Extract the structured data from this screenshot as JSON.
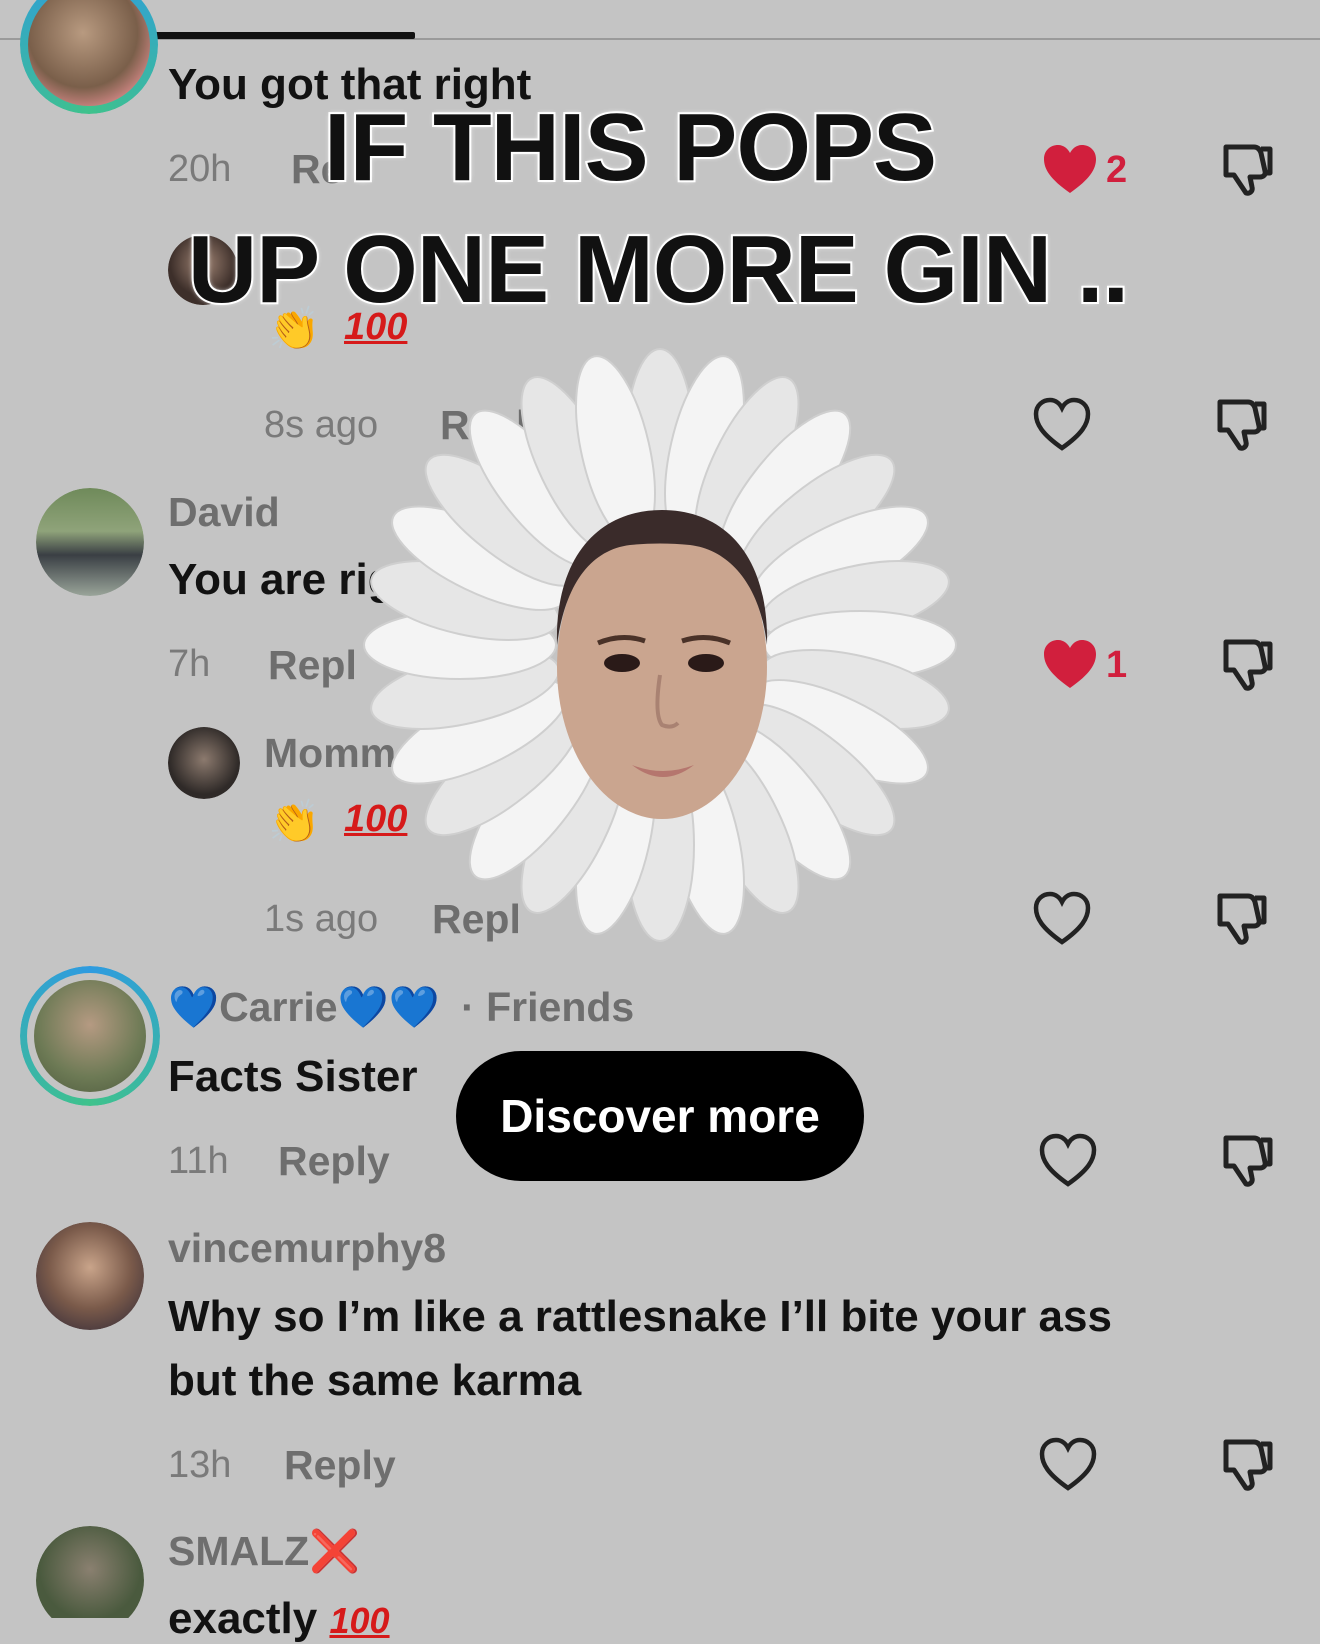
{
  "overlay": {
    "line1": "IF THIS POPS",
    "line2": "UP ONE MORE GIN .."
  },
  "discover": {
    "label": "Discover more"
  },
  "comments": [
    {
      "text": "You got that right",
      "time": "20h",
      "reply": "Re",
      "likes": "2",
      "liked": true,
      "reply_comment": {
        "emoji": "👏",
        "emoji_extra": "100",
        "time": "8s ago",
        "reply": "R",
        "reply_tail": "ly"
      }
    },
    {
      "name": "David",
      "text": "You are righ",
      "time": "7h",
      "reply": "Repl",
      "likes": "1",
      "liked": true,
      "reply_comment": {
        "name": "Momma",
        "emoji": "👏",
        "emoji_extra": "100",
        "time": "1s ago",
        "reply": "Repl"
      }
    },
    {
      "name_prefix": "💙",
      "name": "Carrie",
      "name_suffix": "💙💙",
      "tag": "· Friends",
      "text": "Facts Sister",
      "time": "11h",
      "reply": "Reply"
    },
    {
      "name": "vincemurphy8",
      "text_line1": "Why so I’m like a rattlesnake I’ll bite your ass",
      "text_line2": "but the same karma",
      "time": "13h",
      "reply": "Reply"
    },
    {
      "name": "SMALZ",
      "name_suffix": "❌",
      "text": "exactly",
      "emoji_extra": "100"
    }
  ],
  "icons": {
    "like": "heart-icon",
    "dislike": "thumbs-down-icon"
  },
  "colors": {
    "background": "#c4c4c4",
    "like_red": "#d11f3d",
    "ring_start": "#2e9be0",
    "ring_end": "#3fc28c",
    "discover_bg": "#000000"
  }
}
